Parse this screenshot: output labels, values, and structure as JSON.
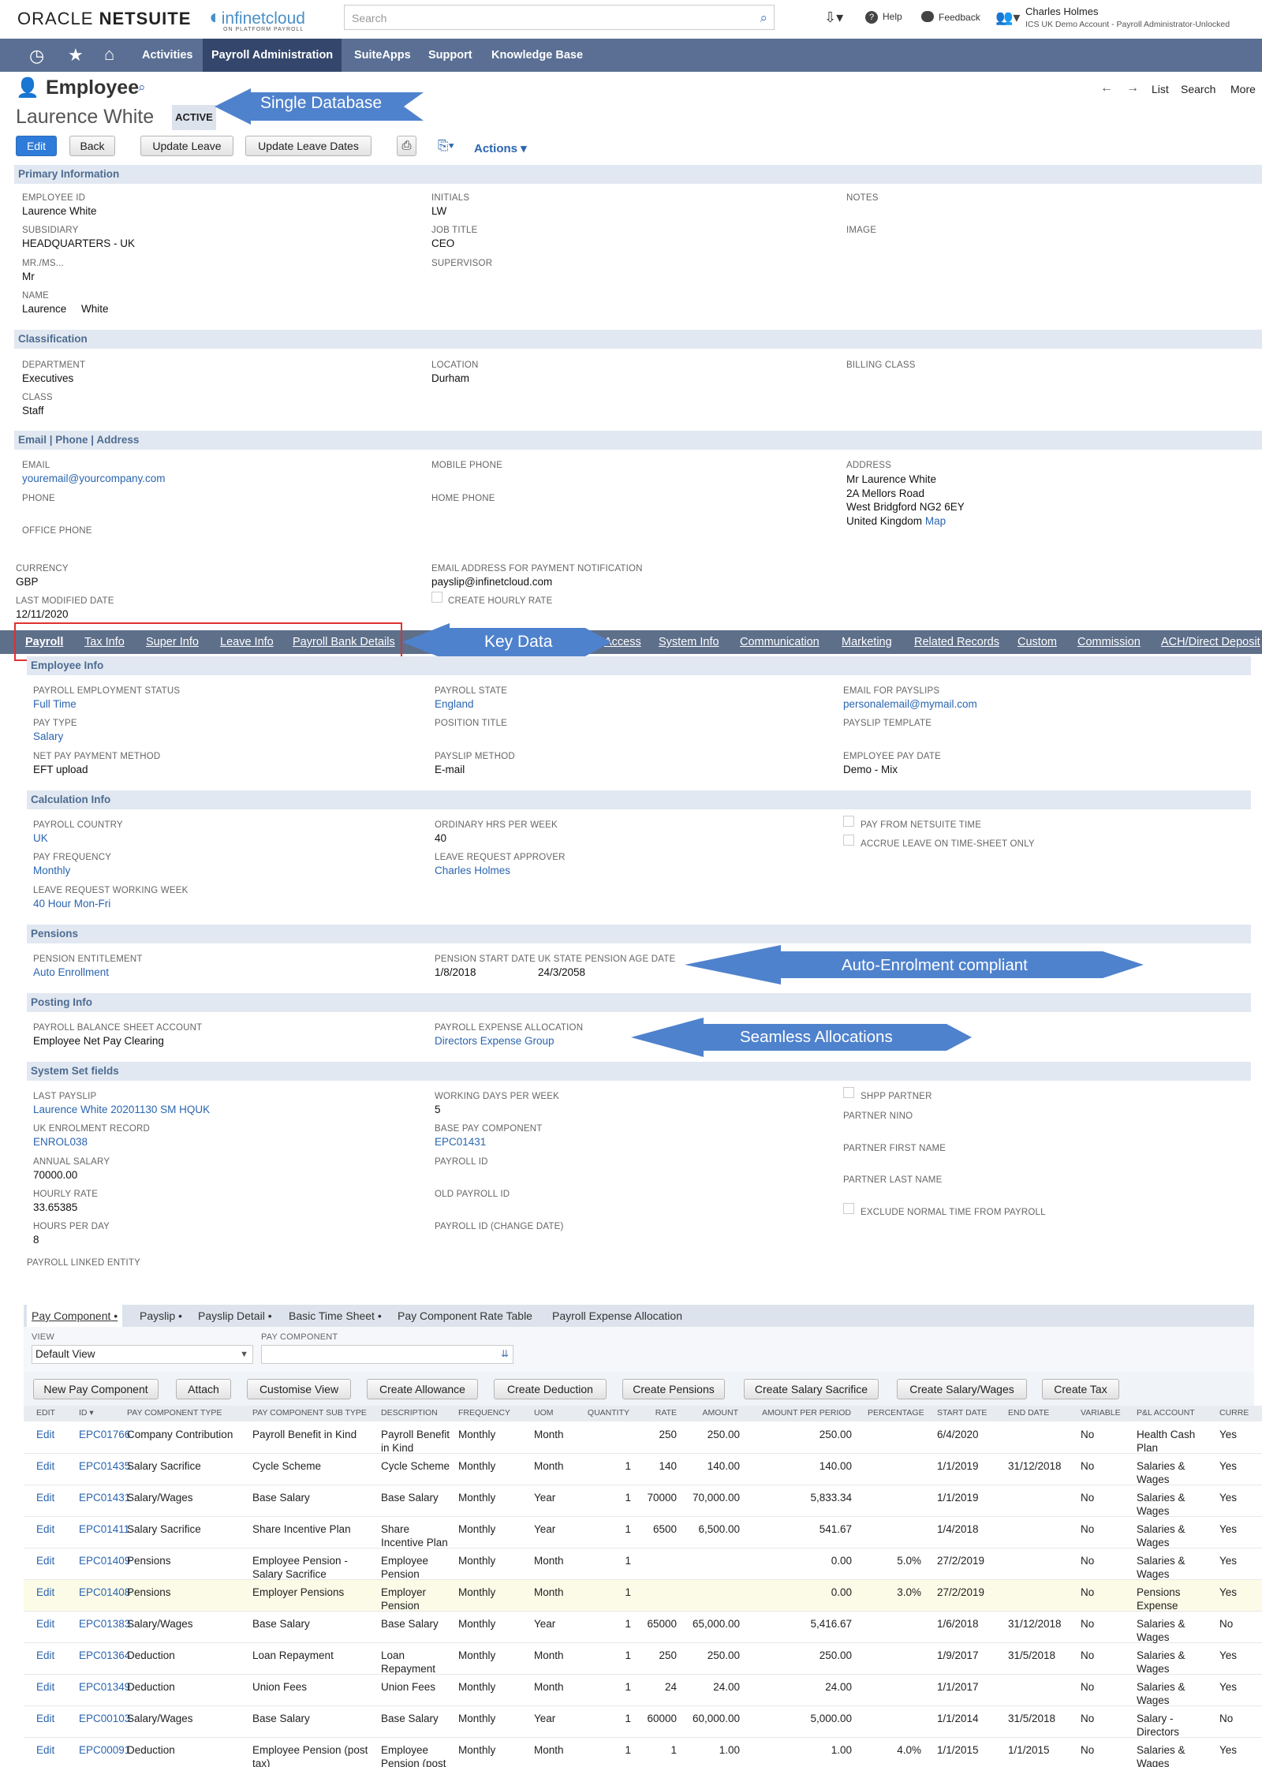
{
  "header": {
    "brand_left": "ORACLE",
    "brand_right": "NETSUITE",
    "partner_logo": "infinetcloud",
    "partner_tagline": "ON PLATFORM PAYROLL",
    "search_placeholder": "Search",
    "help": "Help",
    "feedback": "Feedback",
    "user_name": "Charles Holmes",
    "user_role": "ICS UK Demo Account - Payroll Administrator-Unlocked"
  },
  "nav": {
    "items": [
      "Activities",
      "Payroll Administration",
      "SuiteApps",
      "Support",
      "Knowledge Base"
    ]
  },
  "record": {
    "type": "Employee",
    "name": "Laurence White",
    "status": "ACTIVE",
    "page_nav": [
      "List",
      "Search",
      "More"
    ]
  },
  "buttons": {
    "edit": "Edit",
    "back": "Back",
    "update_leave": "Update Leave",
    "update_leave_dates": "Update Leave Dates",
    "actions": "Actions"
  },
  "callouts": {
    "single_db": "Single Database",
    "key_data": "Key Data",
    "auto_enrol": "Auto-Enrolment compliant",
    "seamless": "Seamless Allocations"
  },
  "primary": {
    "title": "Primary Information",
    "fields": [
      {
        "label": "EMPLOYEE ID",
        "value": "Laurence White"
      },
      {
        "label": "INITIALS",
        "value": "LW"
      },
      {
        "label": "NOTES",
        "value": ""
      },
      {
        "label": "SUBSIDIARY",
        "value": "HEADQUARTERS - UK"
      },
      {
        "label": "JOB TITLE",
        "value": "CEO"
      },
      {
        "label": "IMAGE",
        "value": ""
      },
      {
        "label": "MR./MS...",
        "value": "Mr"
      },
      {
        "label": "SUPERVISOR",
        "value": ""
      },
      {
        "label": "NAME",
        "value": "Laurence     White"
      }
    ]
  },
  "classification": {
    "title": "Classification",
    "fields": [
      {
        "label": "DEPARTMENT",
        "value": "Executives"
      },
      {
        "label": "LOCATION",
        "value": "Durham"
      },
      {
        "label": "BILLING CLASS",
        "value": ""
      },
      {
        "label": "CLASS",
        "value": "Staff"
      }
    ]
  },
  "contact": {
    "title": "Email | Phone | Address",
    "email_label": "EMAIL",
    "email": "youremail@yourcompany.com",
    "mobile_label": "MOBILE PHONE",
    "address_label": "ADDRESS",
    "address": [
      "Mr Laurence White",
      "2A Mellors Road",
      "West Bridgford NG2 6EY",
      "United Kingdom"
    ],
    "map": "Map",
    "phone_label": "PHONE",
    "home_phone_label": "HOME PHONE",
    "office_phone_label": "OFFICE PHONE"
  },
  "misc": {
    "currency_label": "CURRENCY",
    "currency": "GBP",
    "email_pay_label": "EMAIL ADDRESS FOR PAYMENT NOTIFICATION",
    "email_pay": "payslip@infinetcloud.com",
    "modified_label": "LAST MODIFIED DATE",
    "modified": "12/11/2020",
    "hourly_label": "CREATE HOURLY RATE"
  },
  "tabs": [
    "Payroll",
    "Tax Info",
    "Super Info",
    "Leave Info",
    "Payroll Bank Details",
    "Access",
    "System Info",
    "Communication",
    "Marketing",
    "Related Records",
    "Custom",
    "Commission",
    "ACH/Direct Deposit"
  ],
  "employee_info": {
    "title": "Employee Info",
    "fields": [
      {
        "label": "PAYROLL EMPLOYMENT STATUS",
        "value": "Full Time"
      },
      {
        "label": "PAYROLL STATE",
        "value": "England"
      },
      {
        "label": "EMAIL FOR PAYSLIPS",
        "value": "personalemail@mymail.com"
      },
      {
        "label": "PAY TYPE",
        "value": "Salary"
      },
      {
        "label": "POSITION TITLE",
        "value": ""
      },
      {
        "label": "PAYSLIP TEMPLATE",
        "value": ""
      },
      {
        "label": "NET PAY PAYMENT METHOD",
        "value": "EFT upload"
      },
      {
        "label": "PAYSLIP METHOD",
        "value": "E-mail"
      },
      {
        "label": "EMPLOYEE PAY DATE",
        "value": "Demo - Mix"
      }
    ]
  },
  "calc_info": {
    "title": "Calculation Info",
    "fields": [
      {
        "label": "PAYROLL COUNTRY",
        "value": "UK"
      },
      {
        "label": "ORDINARY HRS PER WEEK",
        "value": "40"
      },
      {
        "label": "PAY FROM NETSUITE TIME",
        "value": ""
      },
      {
        "label": "PAY FREQUENCY",
        "value": "Monthly"
      },
      {
        "label": "LEAVE REQUEST APPROVER",
        "value": "Charles Holmes"
      },
      {
        "label": "ACCRUE LEAVE ON TIME-SHEET ONLY",
        "value": ""
      },
      {
        "label": "LEAVE REQUEST WORKING WEEK",
        "value": "40 Hour Mon-Fri"
      }
    ]
  },
  "pensions": {
    "title": "Pensions",
    "entitlement_label": "PENSION ENTITLEMENT",
    "entitlement": "Auto Enrollment",
    "start_label": "PENSION START DATE",
    "start": "1/8/2018",
    "age_label": "UK STATE PENSION AGE DATE",
    "age": "24/3/2058"
  },
  "posting": {
    "title": "Posting Info",
    "bs_label": "PAYROLL BALANCE SHEET ACCOUNT",
    "bs": "Employee Net Pay Clearing",
    "exp_label": "PAYROLL EXPENSE ALLOCATION",
    "exp": "Directors Expense Group"
  },
  "system": {
    "title": "System Set fields",
    "fields": [
      {
        "label": "LAST PAYSLIP",
        "value": "Laurence White 20201130 SM HQUK"
      },
      {
        "label": "WORKING DAYS PER WEEK",
        "value": "5"
      },
      {
        "label": "SHPP PARTNER",
        "value": ""
      },
      {
        "label": "UK ENROLMENT RECORD",
        "value": "ENROL038"
      },
      {
        "label": "BASE PAY COMPONENT",
        "value": "EPC01431"
      },
      {
        "label": "PARTNER NINO",
        "value": ""
      },
      {
        "label": "ANNUAL SALARY",
        "value": "70000.00"
      },
      {
        "label": "PAYROLL ID",
        "value": ""
      },
      {
        "label": "PARTNER FIRST NAME",
        "value": ""
      },
      {
        "label": "HOURLY RATE",
        "value": "33.65385"
      },
      {
        "label": "OLD PAYROLL ID",
        "value": ""
      },
      {
        "label": "PARTNER LAST NAME",
        "value": ""
      },
      {
        "label": "HOURS PER DAY",
        "value": "8"
      },
      {
        "label": "PAYROLL ID (CHANGE DATE)",
        "value": ""
      },
      {
        "label": "EXCLUDE NORMAL TIME FROM PAYROLL",
        "value": ""
      },
      {
        "label": "PAYROLL LINKED ENTITY",
        "value": ""
      }
    ]
  },
  "subtabs": [
    "Pay Component",
    "Payslip",
    "Payslip Detail",
    "Basic Time Sheet",
    "Pay Component Rate Table",
    "Payroll Expense Allocation"
  ],
  "filters": {
    "view_label": "VIEW",
    "view": "Default View",
    "pc_label": "PAY COMPONENT"
  },
  "list_buttons": [
    "New Pay Component",
    "Attach",
    "Customise View",
    "Create Allowance",
    "Create Deduction",
    "Create Pensions",
    "Create Salary Sacrifice",
    "Create Salary/Wages",
    "Create Tax"
  ],
  "columns": [
    "EDIT",
    "ID ▾",
    "PAY COMPONENT TYPE",
    "PAY COMPONENT SUB TYPE",
    "DESCRIPTION",
    "FREQUENCY",
    "UOM",
    "QUANTITY",
    "RATE",
    "AMOUNT",
    "AMOUNT PER PERIOD",
    "PERCENTAGE",
    "START DATE",
    "END DATE",
    "VARIABLE",
    "P&L ACCOUNT",
    "CURRE"
  ],
  "rows": [
    [
      "Edit",
      "EPC01766",
      "Company Contribution",
      "Payroll Benefit in Kind",
      "Payroll Benefit in Kind",
      "Monthly",
      "Month",
      "",
      "250",
      "250.00",
      "250.00",
      "",
      "6/4/2020",
      "",
      "No",
      "Health Cash Plan",
      "Yes"
    ],
    [
      "Edit",
      "EPC01435",
      "Salary Sacrifice",
      "Cycle Scheme",
      "Cycle Scheme",
      "Monthly",
      "Month",
      "1",
      "140",
      "140.00",
      "140.00",
      "",
      "1/1/2019",
      "31/12/2018",
      "No",
      "Salaries & Wages",
      "Yes"
    ],
    [
      "Edit",
      "EPC01431",
      "Salary/Wages",
      "Base Salary",
      "Base Salary",
      "Monthly",
      "Year",
      "1",
      "70000",
      "70,000.00",
      "5,833.34",
      "",
      "1/1/2019",
      "",
      "No",
      "Salaries & Wages",
      "Yes"
    ],
    [
      "Edit",
      "EPC01411",
      "Salary Sacrifice",
      "Share Incentive Plan",
      "Share Incentive Plan",
      "Monthly",
      "Year",
      "1",
      "6500",
      "6,500.00",
      "541.67",
      "",
      "1/4/2018",
      "",
      "No",
      "Salaries & Wages",
      "Yes"
    ],
    [
      "Edit",
      "EPC01409",
      "Pensions",
      "Employee Pension - Salary Sacrifice",
      "Employee Pension",
      "Monthly",
      "Month",
      "1",
      "",
      "",
      "0.00",
      "5.0%",
      "27/2/2019",
      "",
      "No",
      "Salaries & Wages",
      "Yes"
    ],
    [
      "Edit",
      "EPC01408",
      "Pensions",
      "Employer Pensions",
      "Employer Pension",
      "Monthly",
      "Month",
      "1",
      "",
      "",
      "0.00",
      "3.0%",
      "27/2/2019",
      "",
      "No",
      "Pensions Expense",
      "Yes"
    ],
    [
      "Edit",
      "EPC01383",
      "Salary/Wages",
      "Base Salary",
      "Base Salary",
      "Monthly",
      "Year",
      "1",
      "65000",
      "65,000.00",
      "5,416.67",
      "",
      "1/6/2018",
      "31/12/2018",
      "No",
      "Salaries & Wages",
      "No"
    ],
    [
      "Edit",
      "EPC01364",
      "Deduction",
      "Loan Repayment",
      "Loan Repayment",
      "Monthly",
      "Month",
      "1",
      "250",
      "250.00",
      "250.00",
      "",
      "1/9/2017",
      "31/5/2018",
      "No",
      "Salaries & Wages",
      "Yes"
    ],
    [
      "Edit",
      "EPC01349",
      "Deduction",
      "Union Fees",
      "Union Fees",
      "Monthly",
      "Month",
      "1",
      "24",
      "24.00",
      "24.00",
      "",
      "1/1/2017",
      "",
      "No",
      "Salaries & Wages",
      "Yes"
    ],
    [
      "Edit",
      "EPC00103",
      "Salary/Wages",
      "Base Salary",
      "Base Salary",
      "Monthly",
      "Year",
      "1",
      "60000",
      "60,000.00",
      "5,000.00",
      "",
      "1/1/2014",
      "31/5/2018",
      "No",
      "Salary - Directors",
      "No"
    ],
    [
      "Edit",
      "EPC00091",
      "Deduction",
      "Employee Pension (post tax)",
      "Employee Pension (post",
      "Monthly",
      "Month",
      "1",
      "1",
      "1.00",
      "1.00",
      "4.0%",
      "1/1/2015",
      "1/1/2015",
      "No",
      "Salaries & Wages",
      "Yes"
    ]
  ]
}
